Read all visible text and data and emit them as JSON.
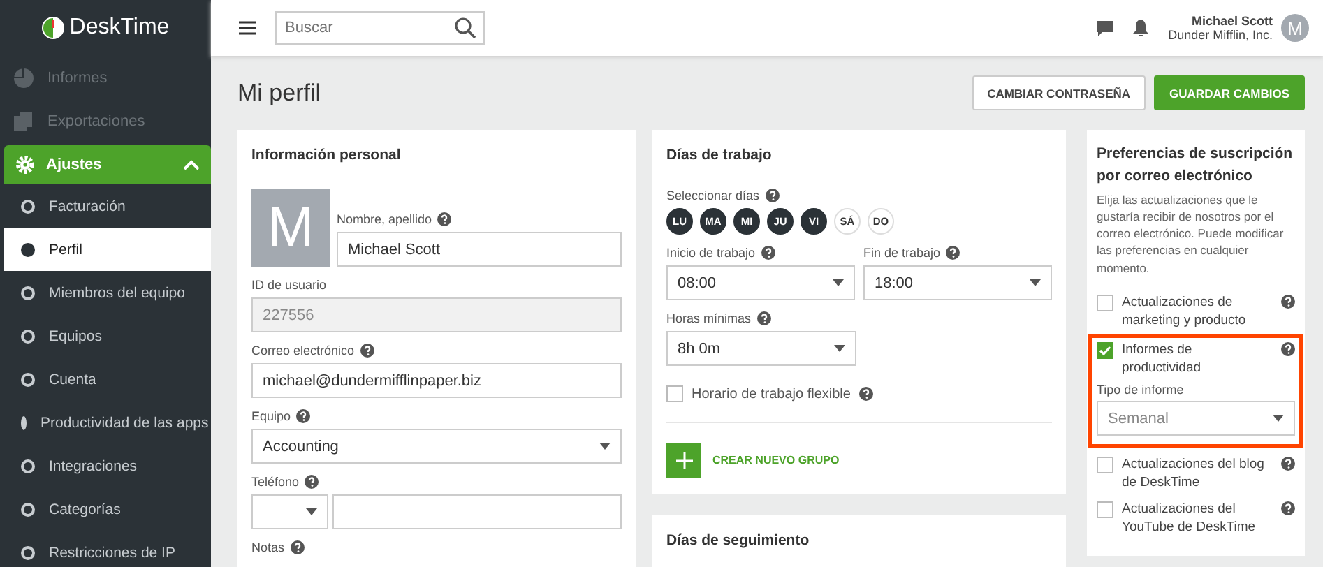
{
  "brand": "DeskTime",
  "search": {
    "placeholder": "Buscar"
  },
  "user": {
    "name": "Michael Scott",
    "company": "Dunder Mifflin, Inc.",
    "initial": "M"
  },
  "sidebar": {
    "items": [
      {
        "label": "Informes",
        "kind": "top",
        "selected": false
      },
      {
        "label": "Exportaciones",
        "kind": "top",
        "selected": false
      },
      {
        "label": "Ajustes",
        "kind": "section",
        "selected": false,
        "expanded": true,
        "children": [
          {
            "label": "Facturación",
            "selected": false
          },
          {
            "label": "Perfil",
            "selected": true
          },
          {
            "label": "Miembros del equipo",
            "selected": false
          },
          {
            "label": "Equipos",
            "selected": false
          },
          {
            "label": "Cuenta",
            "selected": false
          },
          {
            "label": "Productividad de las apps",
            "selected": false
          },
          {
            "label": "Integraciones",
            "selected": false
          },
          {
            "label": "Categorías",
            "selected": false
          },
          {
            "label": "Restricciones de IP",
            "selected": false
          }
        ]
      }
    ]
  },
  "page_title": "Mi perfil",
  "buttons": {
    "secondary": "CAMBIAR CONTRASEÑA",
    "primary": "GUARDAR CAMBIOS"
  },
  "personal": {
    "title": "Información personal",
    "avatar_initial": "M",
    "name_label": "Nombre, apellido",
    "name": "Michael Scott",
    "id_label": "ID de usuario",
    "id": "227556",
    "email_label": "Correo electrónico",
    "email": "michael@dundermifflinpaper.biz",
    "team_label": "Equipo",
    "team": "Accounting",
    "phone_label": "Teléfono",
    "notes_label": "Notas"
  },
  "workdays": {
    "title": "Días de trabajo",
    "select_label": "Seleccionar días",
    "days": [
      {
        "label": "LU",
        "selected": true
      },
      {
        "label": "MA",
        "selected": true
      },
      {
        "label": "MI",
        "selected": true
      },
      {
        "label": "JU",
        "selected": true
      },
      {
        "label": "VI",
        "selected": true
      },
      {
        "label": "SÁ",
        "selected": false
      },
      {
        "label": "DO",
        "selected": false
      }
    ],
    "start_label": "Inicio de trabajo",
    "start": "08:00",
    "end_label": "Fin de trabajo",
    "end": "18:00",
    "min_label": "Horas mínimas",
    "min": "8h 0m",
    "flex_label": "Horario de trabajo flexible",
    "flex_checked": false,
    "new_group": "CREAR NUEVO GRUPO"
  },
  "tracking": {
    "title": "Días de seguimiento"
  },
  "subscriptions": {
    "title": "Preferencias de suscripción por correo electrónico",
    "description": "Elija las actualizaciones que le gustaría recibir de nosotros por el correo electrónico. Puede modificar las preferencias en cualquier momento.",
    "options": [
      {
        "label": "Actualizaciones de marketing y producto",
        "checked": false,
        "highlighted": false
      },
      {
        "label": "Informes de productividad",
        "checked": true,
        "highlighted": true,
        "type_label": "Tipo de informe",
        "type": "Semanal"
      },
      {
        "label": "Actualizaciones del blog de DeskTime",
        "checked": false,
        "highlighted": false
      },
      {
        "label": "Actualizaciones del YouTube de DeskTime",
        "checked": false,
        "highlighted": false
      }
    ]
  }
}
